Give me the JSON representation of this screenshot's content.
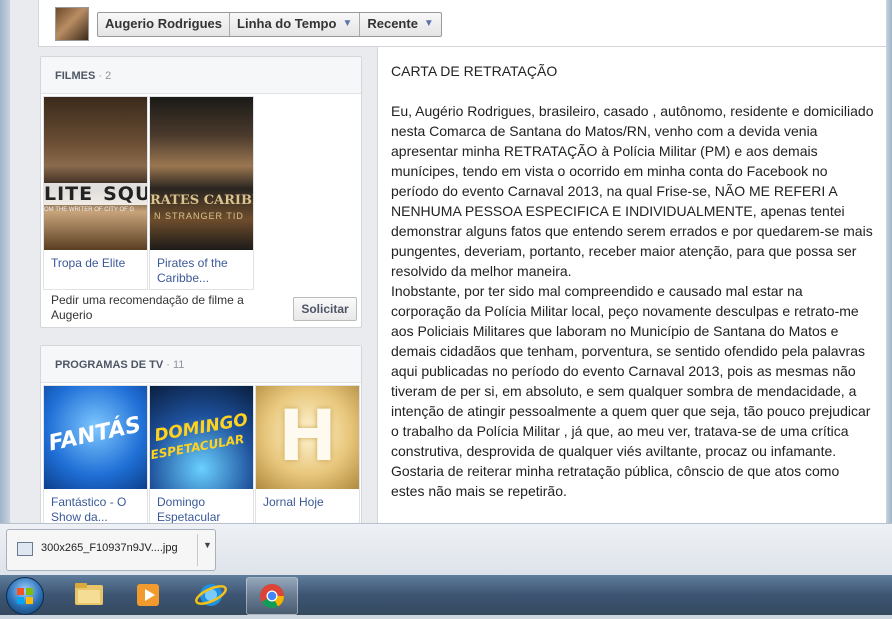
{
  "header": {
    "profile_name": "Augerio Rodrigues",
    "timeline_label": "Linha do Tempo",
    "recent_label": "Recente"
  },
  "films": {
    "title": "FILMES",
    "count": "· 2",
    "items": [
      {
        "title": "Tropa de Elite",
        "poster_text_top": "LITE",
        "poster_text_bottom": "SQU",
        "poster_caption": "OM THE WRITER OF CITY OF G"
      },
      {
        "title": "Pirates of the Caribbe...",
        "poster_text_top": "RATES",
        "poster_text_bottom": "CARIBE",
        "poster_caption": "N STRANGER TID"
      }
    ],
    "recommend_text": "Pedir uma recomendação de filme a Augerio",
    "request_button": "Solicitar"
  },
  "tv": {
    "title": "PROGRAMAS DE TV",
    "count": "· 11",
    "items": [
      {
        "title": "Fantástico - O Show da...",
        "poster_text": "FANTÁS"
      },
      {
        "title": "Domingo Espetacular",
        "poster_text_top": "DOMINGO",
        "poster_text_bottom": "ESPETACULAR"
      },
      {
        "title": "Jornal Hoje",
        "poster_text": "H"
      }
    ]
  },
  "letter": {
    "heading": "CARTA DE RETRATAÇÃO",
    "para1": "Eu, Augério Rodrigues, brasileiro, casado , autônomo, residente e domiciliado nesta Comarca de Santana do Matos/RN, venho com a devida venia apresentar minha RETRATAÇÃO à Polícia Militar (PM) e aos demais munícipes, tendo em vista o ocorrido em minha conta do Facebook no período do evento Carnaval 2013, na qual Frise-se, NÃO ME REFERI A NENHUMA PESSOA ESPECIFICA E INDIVIDUALMENTE, apenas tentei demonstrar alguns fatos que entendo serem errados e por quedarem-se mais pungentes, deveriam, portanto, receber maior atenção, para que possa ser resolvido da melhor maneira.",
    "para2": "Inobstante, por ter sido mal compreendido e causado mal estar na corporação da Polícia Militar local, peço novamente desculpas e retrato-me aos Policiais Militares que laboram no Município de Santana do Matos e demais cidadãos que tenham, porventura, se sentido ofendido pela palavras aqui publicadas no período do evento Carnaval 2013, pois as mesmas não tiveram de per si, em absoluto, e sem qualquer sombra de mendacidade, a intenção de atingir pessoalmente a quem quer que seja, tão pouco prejudicar o trabalho da Polícia Militar , já que, ao meu ver, tratava-se de uma crítica construtiva, desprovida de qualquer viés aviltante, procaz ou infamante.",
    "para3": "Gostaria de reiterar minha retratação pública, cônscio de que atos como estes não mais se repetirão."
  },
  "download": {
    "filename": "300x265_F10937n9JV....jpg"
  },
  "taskbar": {
    "icons": [
      "start-orb",
      "folder-icon",
      "media-player-icon",
      "internet-explorer-icon",
      "chrome-icon"
    ]
  }
}
